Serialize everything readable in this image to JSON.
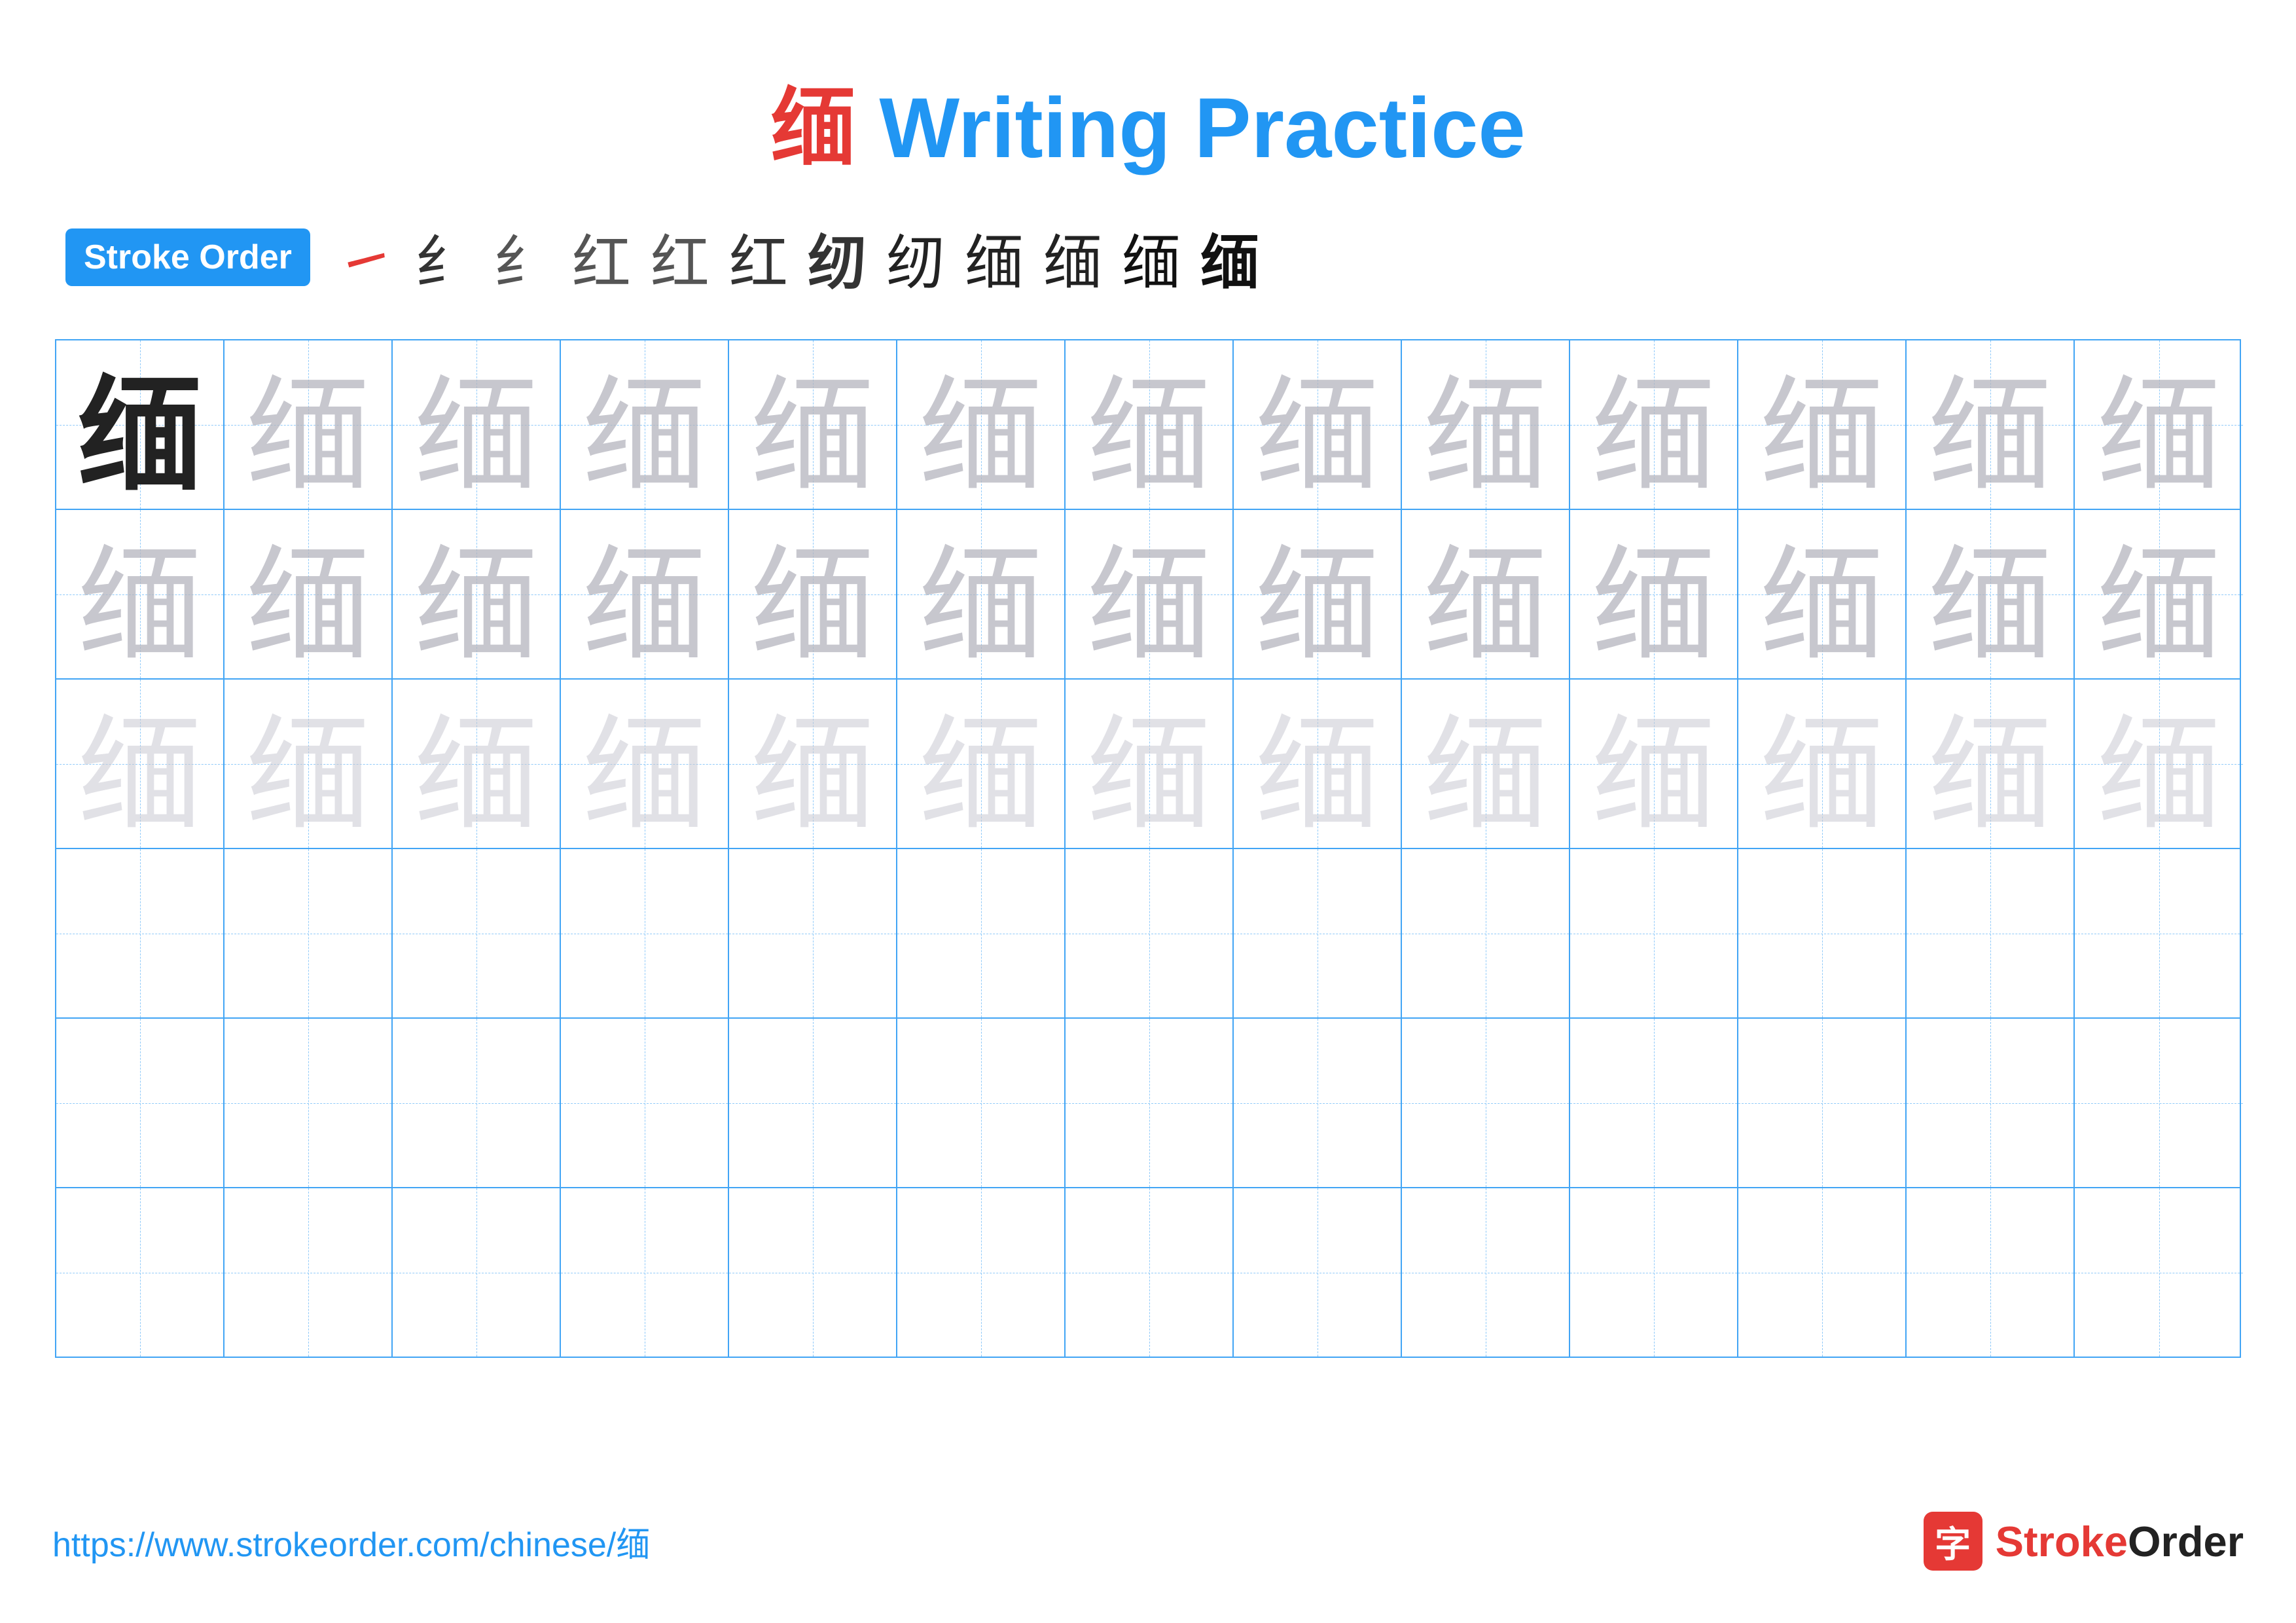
{
  "title": {
    "chinese_char": "缅",
    "rest": " Writing Practice"
  },
  "stroke_order": {
    "badge_label": "Stroke Order",
    "strokes": [
      "㇐",
      "纟",
      "纟",
      "红",
      "红",
      "红",
      "纫",
      "纫",
      "缅",
      "缅",
      "缅",
      "缅"
    ]
  },
  "grid": {
    "rows": 6,
    "cols": 13,
    "character": "缅",
    "row_styles": [
      "dark",
      "medium-gray",
      "light-gray",
      "empty",
      "empty",
      "empty"
    ]
  },
  "footer": {
    "url": "https://www.strokeorder.com/chinese/缅",
    "logo_icon": "字",
    "logo_name": "StrokeOrder"
  }
}
